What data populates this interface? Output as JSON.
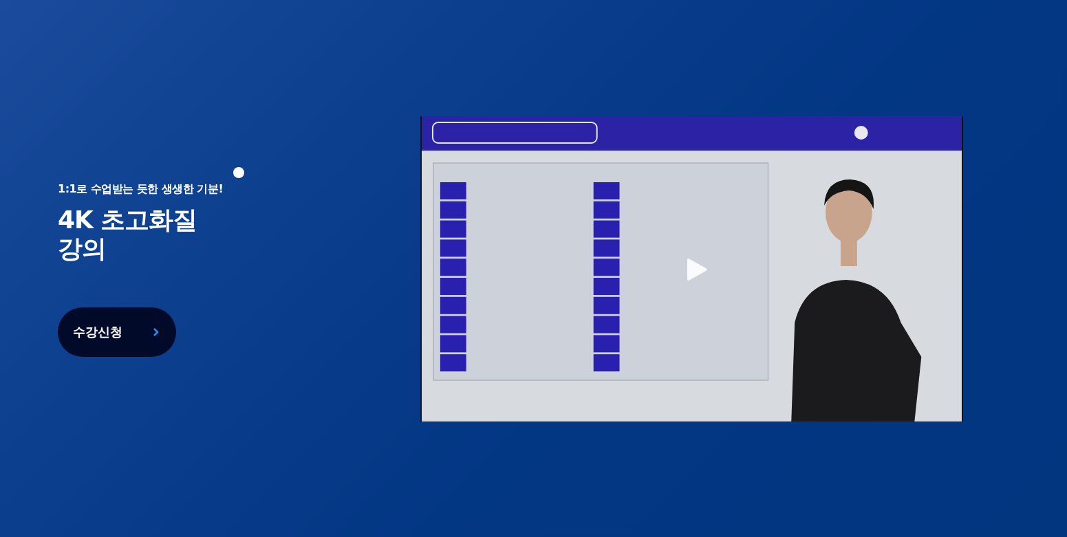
{
  "hero": {
    "subtitle": "1:1로 수업받는 듯한 생생한 기분!",
    "title_lines": [
      "4K 초고화질",
      "강의"
    ],
    "button": {
      "label": "수강신청"
    }
  }
}
